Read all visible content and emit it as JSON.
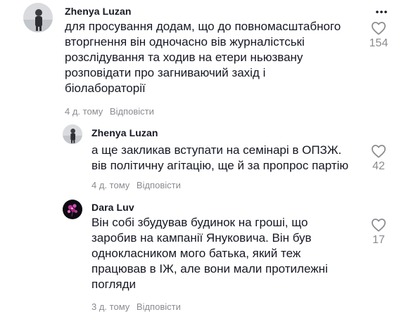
{
  "comments": [
    {
      "username": "Zhenya Luzan",
      "text_lines": [
        "для просування додам, що до повномасштабного",
        "вторгнення він одночасно вів журналістські",
        "розслідування та ходив на етери ньюзвану",
        "розповідати про загниваючий захід і",
        "біолабораторії"
      ],
      "time": "4 д. тому",
      "reply_label": "Відповісти",
      "likes": "154",
      "avatar_icon": "avatar-photo-person"
    },
    {
      "username": "Zhenya Luzan",
      "text_lines": [
        "а ще закликав вступати на семінарі в ОПЗЖ.",
        "вів політичну агітацію, ще й за пропрос партію"
      ],
      "time": "4 д. тому",
      "reply_label": "Відповісти",
      "likes": "42",
      "avatar_icon": "avatar-photo-person"
    },
    {
      "username": "Dara Luv",
      "text_lines": [
        "Він собі збудував будинок на гроші, що",
        "заробив на кампанії Януковича. Він був",
        "однокласником мого батька, який теж",
        "працював в ІЖ, але вони мали протилежні",
        "погляди"
      ],
      "time": "3 д. тому",
      "reply_label": "Відповісти",
      "likes": "17",
      "avatar_icon": "avatar-photo-flower"
    }
  ],
  "icons": {
    "like": "heart-outline-icon",
    "more": "more-dots-icon"
  },
  "colors": {
    "text": "#161823",
    "secondary": "#8a8b91"
  }
}
